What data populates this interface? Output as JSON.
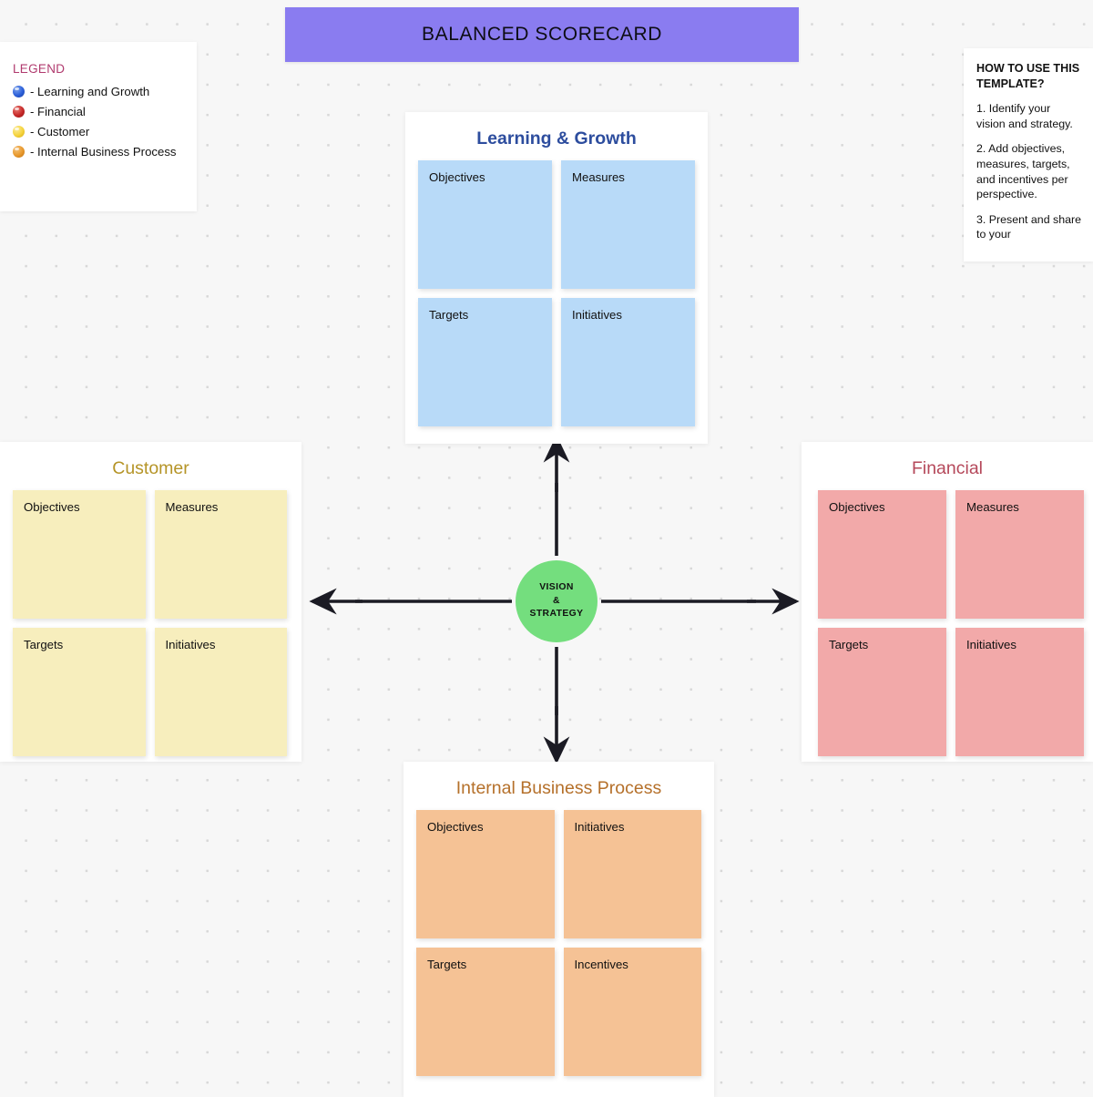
{
  "banner": {
    "title": "BALANCED SCORECARD",
    "color": "#8a7cf0"
  },
  "legend": {
    "title": "LEGEND",
    "title_color": "#b03a6e",
    "items": [
      {
        "label": "- Learning and Growth",
        "color": "#2b5fd9",
        "icon": "blue-dot-icon"
      },
      {
        "label": " - Financial",
        "color": "#c62828",
        "icon": "red-dot-icon"
      },
      {
        "label": "- Customer",
        "color": "#f5d33c",
        "icon": "yellow-dot-icon"
      },
      {
        "label": "- Internal Business Process",
        "color": "#e8982c",
        "icon": "orange-dot-icon"
      }
    ]
  },
  "howto": {
    "title": "HOW TO USE THIS TEMPLATE?",
    "step1": "1. Identify your vision and strategy.",
    "step2": "2. Add objectives, measures, targets, and incentives per perspective.",
    "step3": "3. Present and share to your"
  },
  "center": {
    "line1": "VISION",
    "line2": "&",
    "line3": "STRATEGY",
    "color": "#74de7e"
  },
  "quadrants": {
    "learning": {
      "title": "Learning & Growth",
      "title_color": "#2d4d9e",
      "note_color": "#b8daf8",
      "notes": [
        "Objectives",
        "Measures",
        "Targets",
        "Initiatives"
      ]
    },
    "customer": {
      "title": "Customer",
      "title_color": "#b59427",
      "note_color": "#f7eebd",
      "notes": [
        "Objectives",
        "Measures",
        "Targets",
        "Initiatives"
      ]
    },
    "financial": {
      "title": "Financial",
      "title_color": "#b5485a",
      "note_color": "#f2a9a9",
      "notes": [
        "Objectives",
        "Measures",
        "Targets",
        "Initiatives"
      ]
    },
    "internal": {
      "title": "Internal Business Process",
      "title_color": "#b5702a",
      "note_color": "#f5c295",
      "notes": [
        "Objectives",
        "Initiatives",
        "Targets",
        "Incentives"
      ]
    }
  }
}
